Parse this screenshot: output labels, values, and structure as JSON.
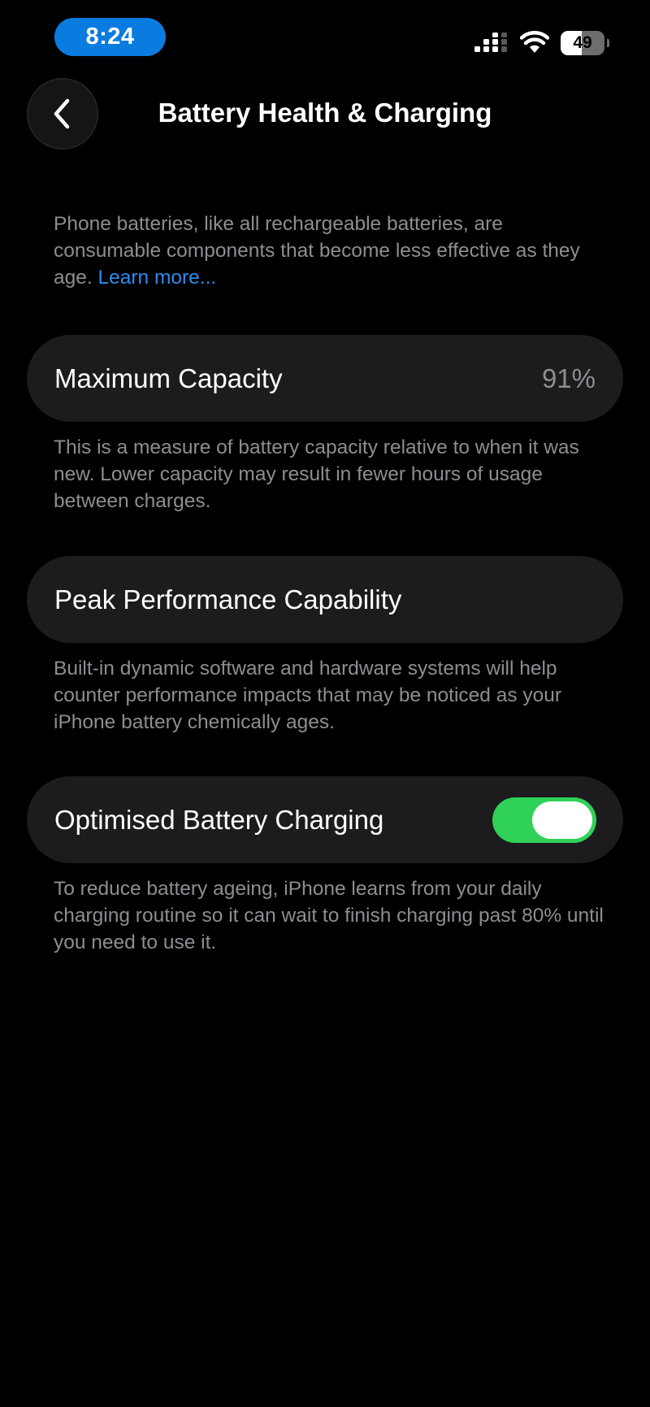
{
  "status_bar": {
    "time": "8:24",
    "battery_level": "49",
    "battery_fraction": 0.49,
    "icons": [
      "cellular-signal-icon",
      "wifi-icon",
      "battery-icon"
    ]
  },
  "nav": {
    "title": "Battery Health & Charging",
    "back_icon": "chevron-left-icon"
  },
  "intro": {
    "text": "Phone batteries, like all rechargeable batteries, are consumable components that become less effective as they age. ",
    "link_text": "Learn more..."
  },
  "maximum_capacity": {
    "label": "Maximum Capacity",
    "value": "91%",
    "footer": "This is a measure of battery capacity relative to when it was new. Lower capacity may result in fewer hours of usage between charges."
  },
  "peak_performance": {
    "label": "Peak Performance Capability",
    "footer": "Built-in dynamic software and hardware systems will help counter performance impacts that may be noticed as your iPhone battery chemically ages."
  },
  "optimised_charging": {
    "label": "Optimised Battery Charging",
    "enabled": true,
    "footer": "To reduce battery ageing, iPhone learns from your daily charging routine so it can wait to finish charging past 80% until you need to use it."
  },
  "colors": {
    "background": "#000000",
    "card": "#1c1c1e",
    "secondary_text": "#8d8d93",
    "link": "#2e8bf0",
    "toggle_on": "#30d158",
    "time_pill": "#0a7ce0"
  }
}
